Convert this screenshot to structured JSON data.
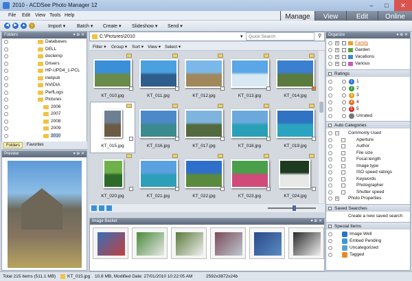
{
  "window": {
    "title": "2010 - ACDSee Photo Manager 12"
  },
  "menu": [
    "File",
    "Edit",
    "View",
    "Tools",
    "Help"
  ],
  "modes": [
    {
      "label": "Manage",
      "active": true
    },
    {
      "label": "View",
      "active": false
    },
    {
      "label": "Edit",
      "active": false
    },
    {
      "label": "Online",
      "active": false
    }
  ],
  "toolbar": {
    "import": "Import",
    "batch": "Batch",
    "create": "Create",
    "slideshow": "Slideshow",
    "send": "Send"
  },
  "folders": {
    "title": "Folders",
    "items": [
      "Databases",
      "DELL",
      "doctemp",
      "Drivers",
      "HP-UPD4_1-PCL",
      "inetpub",
      "NVIDIA",
      "PerfLogs",
      "Pictures",
      "2006",
      "2007",
      "2008",
      "2009",
      "2010"
    ],
    "tabs": [
      "Folders",
      "Favorites"
    ]
  },
  "preview": {
    "title": "Preview"
  },
  "path": {
    "value": "C:\\Pictures\\2010"
  },
  "search": {
    "placeholder": "Quick Search"
  },
  "filterbar": {
    "filter": "Filter",
    "group": "Group",
    "sort": "Sort",
    "view": "View",
    "select": "Select"
  },
  "thumbnails": [
    {
      "name": "KT_010.jpg",
      "c1": "#3a8fd8",
      "c2": "#6a8b4a"
    },
    {
      "name": "KT_011.jpg",
      "c1": "#4ba0e0",
      "c2": "#2e5f8c"
    },
    {
      "name": "KT_012.jpg",
      "c1": "#7ab8ea",
      "c2": "#a0885c"
    },
    {
      "name": "KT_013.jpg",
      "c1": "#5aa6e6",
      "c2": "#d8e8f2"
    },
    {
      "name": "KT_014.jpg",
      "c1": "#3b7fd0",
      "c2": "#5b7a3d"
    },
    {
      "name": "KT_015.jpg",
      "c1": "#6d7f93",
      "c2": "#6b5a44"
    },
    {
      "name": "KT_016.jpg",
      "c1": "#4c89c9",
      "c2": "#3c8a8e"
    },
    {
      "name": "KT_017.jpg",
      "c1": "#7fb4de",
      "c2": "#536a3f"
    },
    {
      "name": "KT_018.jpg",
      "c1": "#6ba9dd",
      "c2": "#2aa0b8"
    },
    {
      "name": "KT_019.jpg",
      "c1": "#2f73c2",
      "c2": "#2aa4c0"
    },
    {
      "name": "KT_020.jpg",
      "c1": "#6fb04a",
      "c2": "#2e6b2a"
    },
    {
      "name": "KT_021.jpg",
      "c1": "#5aa1df",
      "c2": "#2d9fb9"
    },
    {
      "name": "KT_022.jpg",
      "c1": "#2f6fcc",
      "c2": "#5a8a3e"
    },
    {
      "name": "KT_023.jpg",
      "c1": "#4aa04a",
      "c2": "#d04a7a"
    },
    {
      "name": "KT_024.jpg",
      "c1": "#1f3b1f",
      "c2": "#e8e8e8"
    }
  ],
  "basket": {
    "title": "Image Basket",
    "items": [
      {
        "c1": "#3a6fb8",
        "c2": "#c04040"
      },
      {
        "c1": "#4a8a3a",
        "c2": "#e8e8e8"
      },
      {
        "c1": "#5a7a3a",
        "c2": "#f0f0f0"
      },
      {
        "c1": "#7a4a5a",
        "c2": "#c0c8d0"
      },
      {
        "c1": "#2a4a8a",
        "c2": "#5a8ac0"
      },
      {
        "c1": "#2a2a2a",
        "c2": "#f0f0f0"
      }
    ]
  },
  "organize": {
    "title": "Organize",
    "categories": [
      "Family",
      "Garden",
      "Vacations",
      "Various"
    ],
    "ratings_title": "Ratings",
    "ratings": [
      {
        "num": "1",
        "color": "#2a6fd0"
      },
      {
        "num": "2",
        "color": "#2a9a3a"
      },
      {
        "num": "3",
        "color": "#e0a020"
      },
      {
        "num": "4",
        "color": "#e07020"
      },
      {
        "num": "5",
        "color": "#d02a2a"
      }
    ],
    "unrated": "Unrated",
    "auto_title": "Auto Categories",
    "auto_items": [
      "Commonly Used",
      "Aperture",
      "Author",
      "File size",
      "Focal length",
      "Image type",
      "ISO speed ratings",
      "Keywords",
      "Photographer",
      "Shutter speed",
      "Photo Properties"
    ],
    "saved_title": "Saved Searches",
    "saved_new": "Create a new saved search",
    "special_title": "Special Items",
    "special_items": [
      "Image Well",
      "Embed Pending",
      "Uncategorized",
      "Tagged"
    ]
  },
  "status": {
    "total": "Total 215 items  (511.1 MB)",
    "file": "KT_015.jpg",
    "info": "10.8 MB, Modified Date: 27/01/2010 10:22:05 AM",
    "dims": "2592x3872x24b"
  }
}
